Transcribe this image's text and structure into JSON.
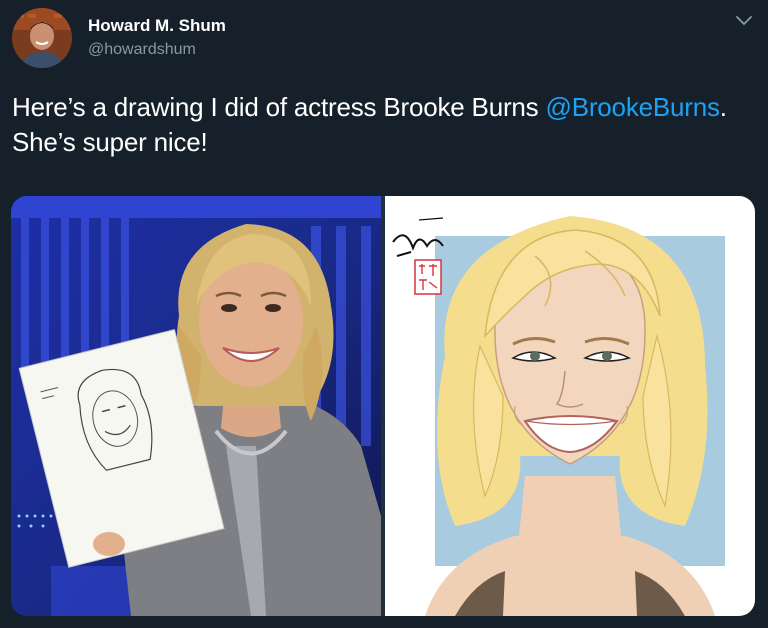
{
  "tweet": {
    "author_name": "Howard M. Shum",
    "author_handle": "@howardshum",
    "text_before": "Here’s a drawing I did of actress Brooke Burns ",
    "mention": "@BrookeBurns",
    "text_after": ". She’s super nice!"
  },
  "icons": {
    "menu": "chevron-down-icon",
    "avatar": "avatar"
  },
  "colors": {
    "background": "#15202b",
    "mention": "#1da1f2",
    "handle": "#8899a6"
  }
}
